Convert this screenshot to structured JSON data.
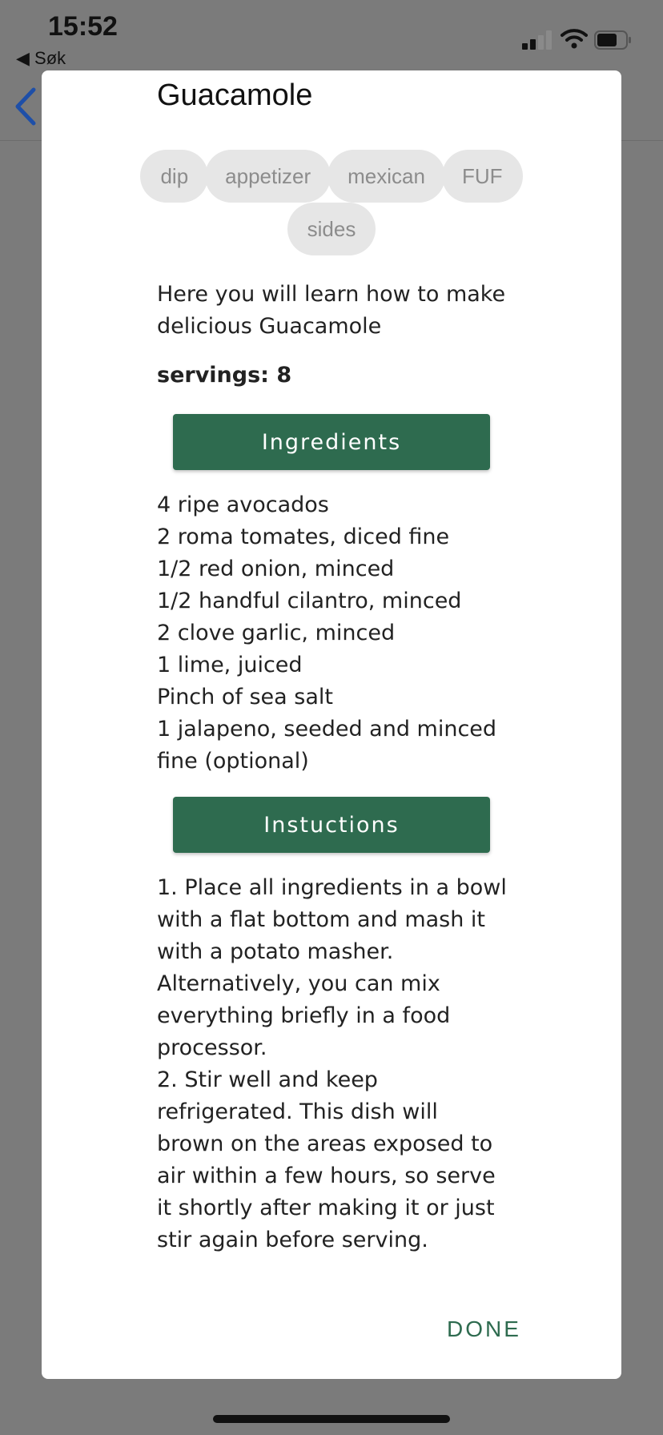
{
  "status_bar": {
    "time": "15:52",
    "back_app_label": "◀ Søk"
  },
  "modal": {
    "title": "Guacamole",
    "tags": [
      "dip",
      "appetizer",
      "mexican",
      "FUF",
      "sides"
    ],
    "description": "Here you will learn how to make delicious Guacamole",
    "servings_label": "servings: 8",
    "ingredients_button": "Ingredients",
    "ingredients": [
      "4 ripe avocados",
      "2 roma tomates, diced fine",
      "1/2 red onion, minced",
      "1/2 handful cilantro, minced",
      "2 clove garlic, minced",
      "1 lime, juiced",
      "Pinch of sea salt",
      "1 jalapeno, seeded and minced fine (optional)"
    ],
    "instructions_button": "Instuctions",
    "instructions": [
      "1. Place all ingredients in a bowl with a flat bottom and mash it with a potato masher. Alternatively, you can mix everything briefly in a food processor.",
      "2. Stir well and keep refrigerated. This dish will brown on the areas exposed to air within a few hours, so serve it shortly after making it or just stir again before serving."
    ],
    "done_label": "DONE"
  },
  "colors": {
    "accent": "#2e6b4f",
    "backdrop": "#7b7b7b",
    "tag_bg": "#e6e6e6",
    "nav_back": "#1e4fa8"
  },
  "icons": {
    "nav_back": "chevron-left-icon",
    "signal": "cellular-signal-icon",
    "wifi": "wifi-icon",
    "battery": "battery-icon"
  }
}
